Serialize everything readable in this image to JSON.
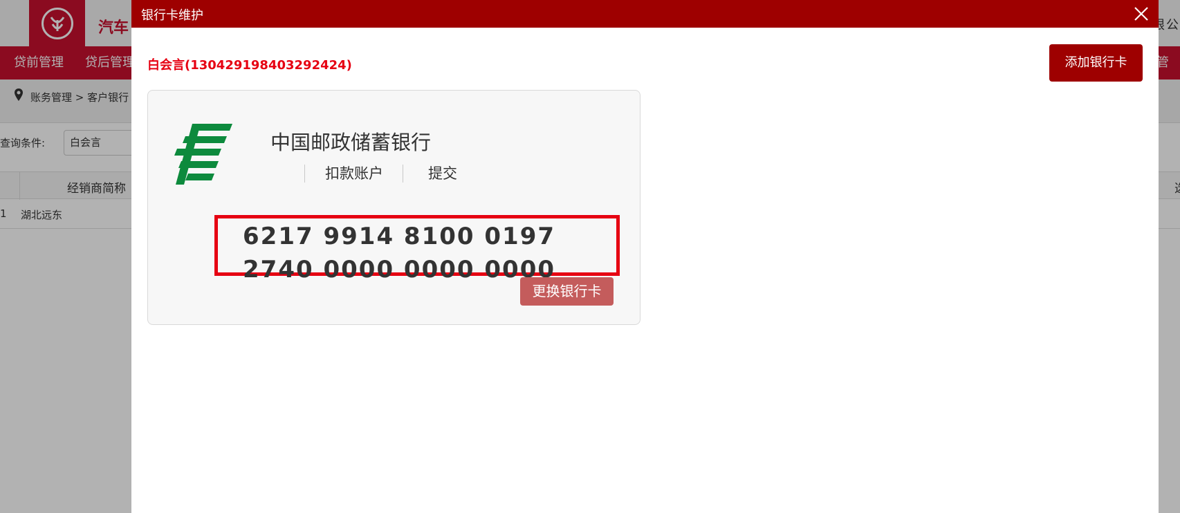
{
  "background": {
    "brand_text": "汽车",
    "company_text": "限公",
    "nav_items": [
      "贷前管理",
      "贷后管理",
      "管理"
    ],
    "breadcrumb": "账务管理  >  客户银行",
    "query_label": "查询条件:",
    "query_value": "白会言",
    "table": {
      "header_name": "经销商简称",
      "header_right": "选",
      "rows": [
        {
          "index": "1",
          "name": "湖北远东"
        }
      ]
    }
  },
  "modal": {
    "title": "银行卡维护",
    "close_icon": "close-icon",
    "customer_label": "白会言(130429198403292424)",
    "add_card_button": "添加银行卡",
    "card": {
      "bank_name": "中国邮政储蓄银行",
      "account_type": "扣款账户",
      "status": "提交",
      "card_number": "6217 9914 8100 0197 2740 0000 0000 0000",
      "replace_button": "更换银行卡",
      "bank_logo_icon": "postal-savings-bank-logo-icon"
    }
  },
  "colors": {
    "brand_red": "#c8102e",
    "modal_title_bg": "#9e0000",
    "highlight_red": "#e60012",
    "logo_green": "#0d8a3d",
    "replace_button_bg": "#c45c5c"
  }
}
